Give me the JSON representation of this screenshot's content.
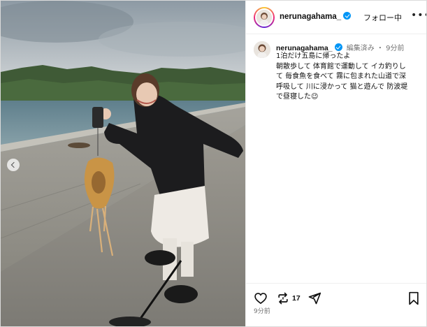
{
  "post": {
    "username": "nerunagahama_",
    "follow_label": "フォロー中",
    "more_label": "•••",
    "caption": {
      "username": "nerunagahama_",
      "meta": "編集済み ・ 9分前",
      "lines": [
        "1泊だけ五島に帰ったよ",
        "朝散歩して 体育館で運動して イカ釣りし",
        "て 毎食魚を食べて 霧に包まれた山道で深",
        "呼吸して 川に浸かって 猫と遊んで 防波堤",
        "で昼寝した😉"
      ]
    },
    "actions": {
      "repost_count": "17"
    },
    "timestamp": "9分前"
  },
  "icons": {
    "like": "heart-icon",
    "repost": "repost-icon",
    "share": "paper-plane-icon",
    "save": "bookmark-icon",
    "verified": "verified-badge-icon",
    "carousel_prev": "chevron-left-icon"
  },
  "colors": {
    "verified": "#0095f6",
    "text": "#111111",
    "muted": "#737373",
    "border": "#dbdbdb"
  }
}
